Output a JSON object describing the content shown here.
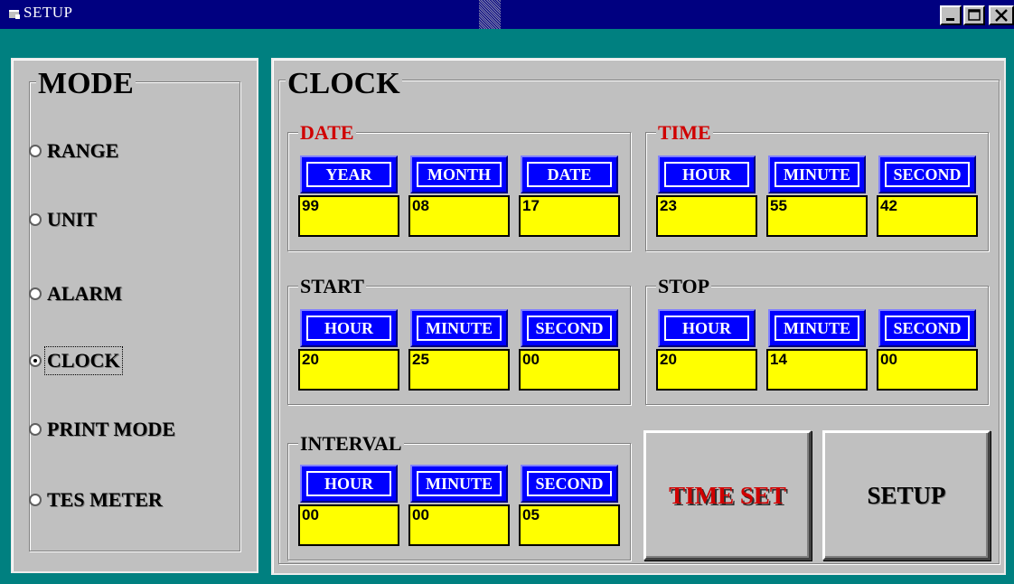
{
  "window": {
    "title": "SETUP",
    "controls": {
      "minimize": "minimize-icon",
      "maximize": "maximize-icon",
      "close": "close-icon"
    }
  },
  "mode": {
    "legend": "MODE",
    "options": [
      {
        "label": "RANGE",
        "selected": false
      },
      {
        "label": "UNIT",
        "selected": false
      },
      {
        "label": "ALARM",
        "selected": false
      },
      {
        "label": "CLOCK",
        "selected": true
      },
      {
        "label": "PRINT MODE",
        "selected": false
      },
      {
        "label": "TES METER",
        "selected": false
      }
    ]
  },
  "clock": {
    "legend": "CLOCK",
    "date": {
      "legend": "DATE",
      "headers": [
        "YEAR",
        "MONTH",
        "DATE"
      ],
      "values": [
        "99",
        "08",
        "17"
      ]
    },
    "time": {
      "legend": "TIME",
      "headers": [
        "HOUR",
        "MINUTE",
        "SECOND"
      ],
      "values": [
        "23",
        "55",
        "42"
      ]
    },
    "start": {
      "legend": "START",
      "headers": [
        "HOUR",
        "MINUTE",
        "SECOND"
      ],
      "values": [
        "20",
        "25",
        "00"
      ]
    },
    "stop": {
      "legend": "STOP",
      "headers": [
        "HOUR",
        "MINUTE",
        "SECOND"
      ],
      "values": [
        "20",
        "14",
        "00"
      ]
    },
    "interval": {
      "legend": "INTERVAL",
      "headers": [
        "HOUR",
        "MINUTE",
        "SECOND"
      ],
      "values": [
        "00",
        "00",
        "05"
      ]
    },
    "buttons": {
      "time_set": "TIME SET",
      "setup": "SETUP"
    }
  },
  "colors": {
    "desktop": "#008080",
    "titlebar": "#000080",
    "face": "#c0c0c0",
    "header_cell": "#0000ff",
    "value_cell": "#ffff00",
    "accent_red": "#d00000"
  }
}
